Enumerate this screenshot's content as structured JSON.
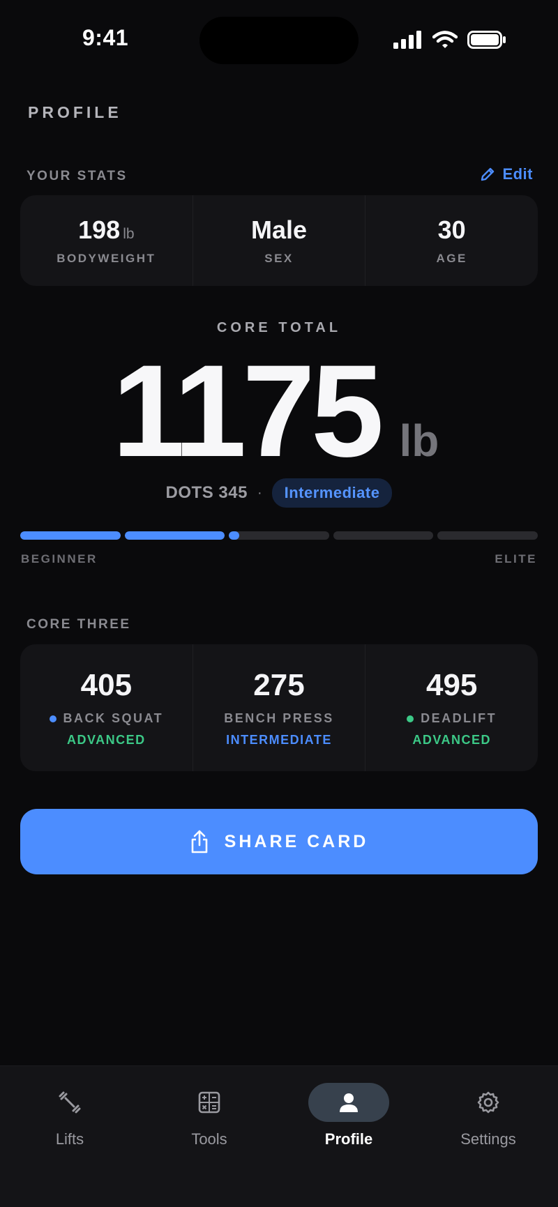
{
  "status_bar": {
    "time": "9:41"
  },
  "page": {
    "title": "PROFILE"
  },
  "stats": {
    "section_label": "YOUR STATS",
    "edit_label": "Edit",
    "items": [
      {
        "value": "198",
        "unit": "lb",
        "label": "BODYWEIGHT"
      },
      {
        "value": "Male",
        "unit": "",
        "label": "SEX"
      },
      {
        "value": "30",
        "unit": "",
        "label": "AGE"
      }
    ]
  },
  "core_total": {
    "label": "CORE TOTAL",
    "value": "1175",
    "unit": "lb",
    "dots_text": "DOTS 345",
    "separator": "·",
    "level": "Intermediate",
    "progress": 0.42,
    "progress_segments": 5,
    "scale_start_label": "BEGINNER",
    "scale_end_label": "ELITE"
  },
  "core_three": {
    "section_label": "CORE THREE",
    "lifts": [
      {
        "value": "405",
        "name": "BACK SQUAT",
        "level": "ADVANCED",
        "dot_color": "#4c8dff",
        "level_color": "#3cc987",
        "show_dot": true
      },
      {
        "value": "275",
        "name": "BENCH PRESS",
        "level": "INTERMEDIATE",
        "dot_color": "",
        "level_color": "#4c8dff",
        "show_dot": false
      },
      {
        "value": "495",
        "name": "DEADLIFT",
        "level": "ADVANCED",
        "dot_color": "#3cc987",
        "level_color": "#3cc987",
        "show_dot": true
      }
    ]
  },
  "share": {
    "label": "SHARE CARD",
    "icon": "share-icon"
  },
  "tabs": [
    {
      "label": "Lifts",
      "icon": "dumbbell-icon",
      "active": false
    },
    {
      "label": "Tools",
      "icon": "calculator-icon",
      "active": false
    },
    {
      "label": "Profile",
      "icon": "person-icon",
      "active": true
    },
    {
      "label": "Settings",
      "icon": "gear-icon",
      "active": false
    }
  ],
  "colors": {
    "accent": "#4c8dff",
    "advanced": "#3cc987",
    "background": "#0a0a0c",
    "card": "#141417"
  }
}
